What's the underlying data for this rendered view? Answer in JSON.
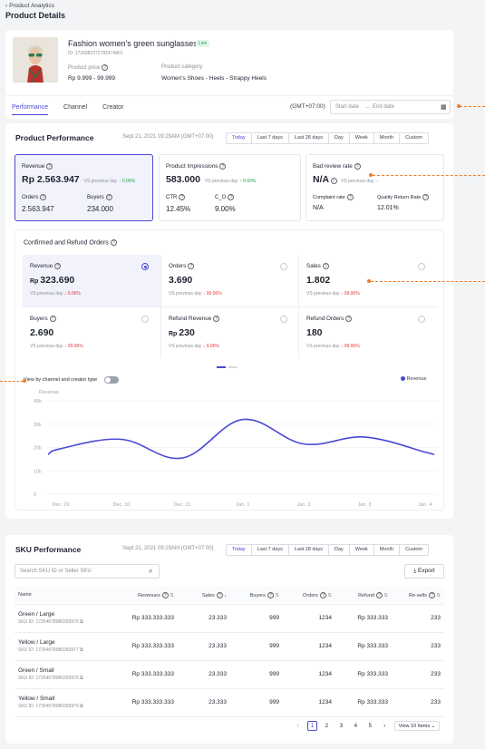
{
  "header": {
    "breadcrumb": "Product Analytics",
    "title": "Product Details"
  },
  "product": {
    "name": "Fashion women's green sunglasses",
    "live_badge": "Live",
    "id": "ID: 1729382372782474801",
    "price_label": "Product price",
    "price": "Rp 9.999 - 99.999",
    "category_label": "Product category",
    "category": "Women's Shoes - Heels - Strappy Heels"
  },
  "tabs": [
    "Performance",
    "Channel",
    "Creator"
  ],
  "date_filter": {
    "timezone": "(GMT+07:00)",
    "start_placeholder": "Start date",
    "sep": "→",
    "end_placeholder": "End date"
  },
  "performance": {
    "title": "Product Performance",
    "timestamp": "Sept 21, 2021 09:29AM (GMT+07:00)",
    "ranges": [
      "Today",
      "Last 7 days",
      "Last 28 days",
      "Day",
      "Week",
      "Month",
      "Custom"
    ],
    "revenue": {
      "label": "Revenue",
      "value": "Rp 2.563.947",
      "compare": "VS previous day",
      "change": "↑ 0.09%",
      "orders_label": "Orders",
      "orders": "2.563.947",
      "buyers_label": "Buyers",
      "buyers": "234.000"
    },
    "impressions": {
      "label": "Product Impressions",
      "value": "583.000",
      "compare": "VS previous day",
      "change": "↑ 0.09%",
      "ctr_label": "CTR",
      "ctr": "12.45%",
      "co_label": "C_O",
      "co": "9.00%"
    },
    "bad_review": {
      "label": "Bad review rate",
      "value": "N/A",
      "compare": "VS previous day",
      "change": "--",
      "complaint_label": "Complaint rate",
      "complaint": "N/A",
      "return_label": "Quality Return Rate",
      "return": "12.01%"
    }
  },
  "orders_section": {
    "title": "Confirmed and Refund Orders",
    "cards": [
      {
        "label": "Revenue",
        "currency": "Rp",
        "value": "323.690",
        "compare": "VS previous day",
        "change": "↓ 9.06%"
      },
      {
        "label": "Orders",
        "currency": "",
        "value": "3.690",
        "compare": "VS previous day",
        "change": "↓ 99.06%"
      },
      {
        "label": "Sales",
        "currency": "",
        "value": "1.802",
        "compare": "VS previous day",
        "change": "↓ 99.06%"
      },
      {
        "label": "Buyers",
        "currency": "",
        "value": "2.690",
        "compare": "VS previous day",
        "change": "↓ 99.06%"
      },
      {
        "label": "Refund Revenue",
        "currency": "Rp",
        "value": "230",
        "compare": "VS previous day",
        "change": "↓ 9.06%"
      },
      {
        "label": "Refund Orders",
        "currency": "",
        "value": "180",
        "compare": "VS previous day",
        "change": "↓ 99.06%"
      }
    ],
    "toggle_label": "View by channel and creator type",
    "legend": "Revenue"
  },
  "chart_data": {
    "type": "line",
    "ylabel": "Revenue",
    "categories": [
      "Dec. 29",
      "Dec. 30",
      "Dec. 31",
      "Jan. 1",
      "Jan. 2",
      "Jan. 3",
      "Jan. 4"
    ],
    "y_ticks": [
      "0",
      "10k",
      "20k",
      "30k",
      "40k"
    ],
    "ylim": [
      0,
      40000
    ],
    "series": [
      {
        "name": "Revenue",
        "color": "#4a49d6",
        "values": [
          19500,
          23500,
          15500,
          32000,
          21500,
          24500,
          18000
        ]
      }
    ],
    "legend_position": "top-right"
  },
  "sku": {
    "title": "SKU Performance",
    "timestamp": "Sept 21, 2021 09:29AM (GMT+07:00)",
    "ranges": [
      "Today",
      "Last 7 days",
      "Last 28 days",
      "Day",
      "Week",
      "Month",
      "Custom"
    ],
    "search_placeholder": "Search SKU ID or Seller SKU",
    "export_label": "Export",
    "columns": [
      "Name",
      "Revenues",
      "Sales",
      "Buyers",
      "Orders",
      "Refund",
      "Re-sells"
    ],
    "rows": [
      {
        "name": "Green / Large",
        "sku_id": "SKU ID: 17264678980283976",
        "revenue": "Rp 333.333.333",
        "sales": "23.333",
        "buyers": "999",
        "orders": "1234",
        "refund": "Rp 333.333",
        "resells": "233"
      },
      {
        "name": "Yellow / Large",
        "sku_id": "SKU ID: 17264678980283977",
        "revenue": "Rp 333.333.333",
        "sales": "23.333",
        "buyers": "999",
        "orders": "1234",
        "refund": "Rp 333.333",
        "resells": "233"
      },
      {
        "name": "Green / Small",
        "sku_id": "SKU ID: 17264678980283978",
        "revenue": "Rp 333.333.333",
        "sales": "23.333",
        "buyers": "999",
        "orders": "1234",
        "refund": "Rp 333.333",
        "resells": "233"
      },
      {
        "name": "Yellow / Small",
        "sku_id": "SKU ID: 17394678980283979",
        "revenue": "Rp 333.333.333",
        "sales": "23.333",
        "buyers": "999",
        "orders": "1234",
        "refund": "Rp 333.333",
        "resells": "233"
      }
    ],
    "pagination": {
      "pages": [
        "1",
        "2",
        "3",
        "4",
        "5"
      ],
      "per_page": "View 10 Items"
    }
  },
  "colors": {
    "accent": "#4a49d6",
    "annotation": "#f07a26",
    "up": "#17a34a",
    "down": "#e23b3b"
  }
}
